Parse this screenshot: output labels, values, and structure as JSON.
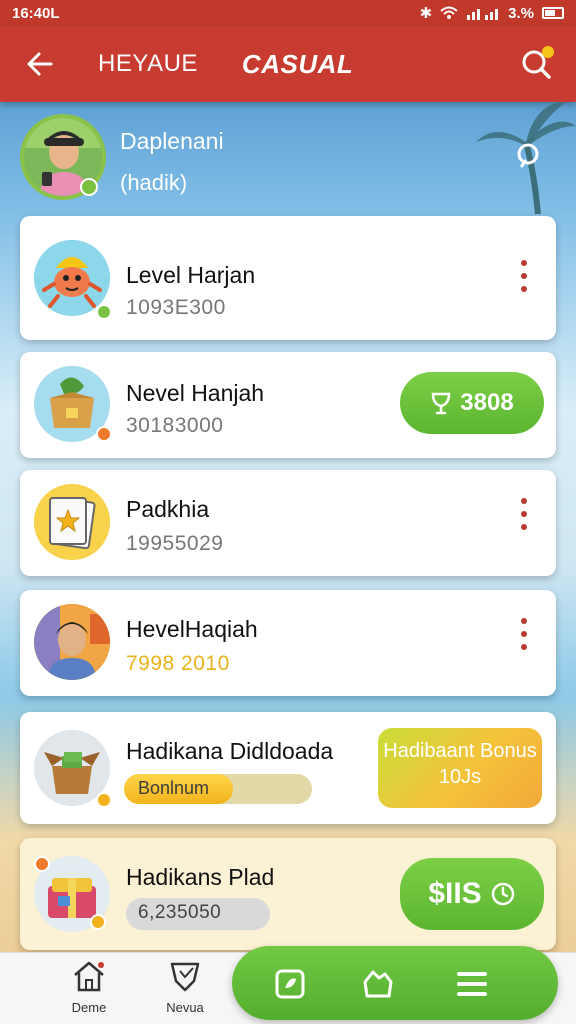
{
  "status_bar": {
    "time": "16:40L",
    "battery": "3.%"
  },
  "app_bar": {
    "tab_1": "HEYAUE",
    "tab_2": "CASUAL"
  },
  "profile": {
    "name": "Daplenani",
    "subtitle": "(hadik)"
  },
  "cards": [
    {
      "title": "Level Harjan",
      "value": "1093E300"
    },
    {
      "title": "Nevel Hanjah",
      "value": "30183000",
      "button_label": "3808"
    },
    {
      "title": "Padkhia",
      "value": "19955029"
    },
    {
      "title": "HevelHaqiah",
      "value": "7998 2010"
    },
    {
      "title": "Hadikana Didldoada",
      "progress_label": "Bonlnum",
      "progress": 0.58,
      "button_label": "Hadibaant Bonus 10Js"
    },
    {
      "title": "Hadikans Plad",
      "value": "6,235050",
      "button_label": "$IIS"
    }
  ],
  "bottom_nav": {
    "home_label": "Deme",
    "news_label": "Nevua"
  },
  "colors": {
    "primary_red": "#c73b30",
    "accent_green": "#5cb531",
    "accent_yellow": "#f5c23a"
  }
}
